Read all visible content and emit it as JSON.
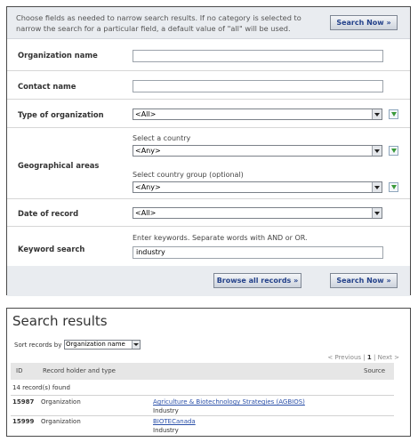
{
  "form": {
    "instructions": "Choose fields as needed to narrow search results. If no category is selected to narrow the search for a particular field, a default value of \"all\" will be used.",
    "search_button_top": "Search Now »",
    "organization_name": {
      "label": "Organization name",
      "value": ""
    },
    "contact_name": {
      "label": "Contact name",
      "value": ""
    },
    "type_of_organization": {
      "label": "Type of organization",
      "selected": "<All>"
    },
    "geographical_areas": {
      "label": "Geographical areas",
      "country_label": "Select a country",
      "country_selected": "<Any>",
      "group_label": "Select country group (optional)",
      "group_selected": "<Any>"
    },
    "date_of_record": {
      "label": "Date of record",
      "selected": "<All>"
    },
    "keyword_search": {
      "label": "Keyword search",
      "hint": "Enter keywords. Separate words with AND or OR.",
      "value": "industry"
    },
    "browse_button": "Browse all records »",
    "search_button_bottom": "Search Now »"
  },
  "results": {
    "title": "Search results",
    "sort_label": "Sort records by",
    "sort_selected": "Organization name",
    "pagination": {
      "prev": "< Previous",
      "sep1": "|",
      "current": "1",
      "sep2": "|",
      "next": "Next >"
    },
    "columns": {
      "id": "ID",
      "holder": "Record holder and type",
      "source": "Source"
    },
    "found_text": "14 record(s) found",
    "rows": [
      {
        "id": "15987",
        "type": "Organization",
        "name": "Agriculture & Biotechnology Strategies (AGBIOS)",
        "category": "Industry"
      },
      {
        "id": "15999",
        "type": "Organization",
        "name": "BIOTECanada",
        "category": "Industry"
      }
    ]
  }
}
